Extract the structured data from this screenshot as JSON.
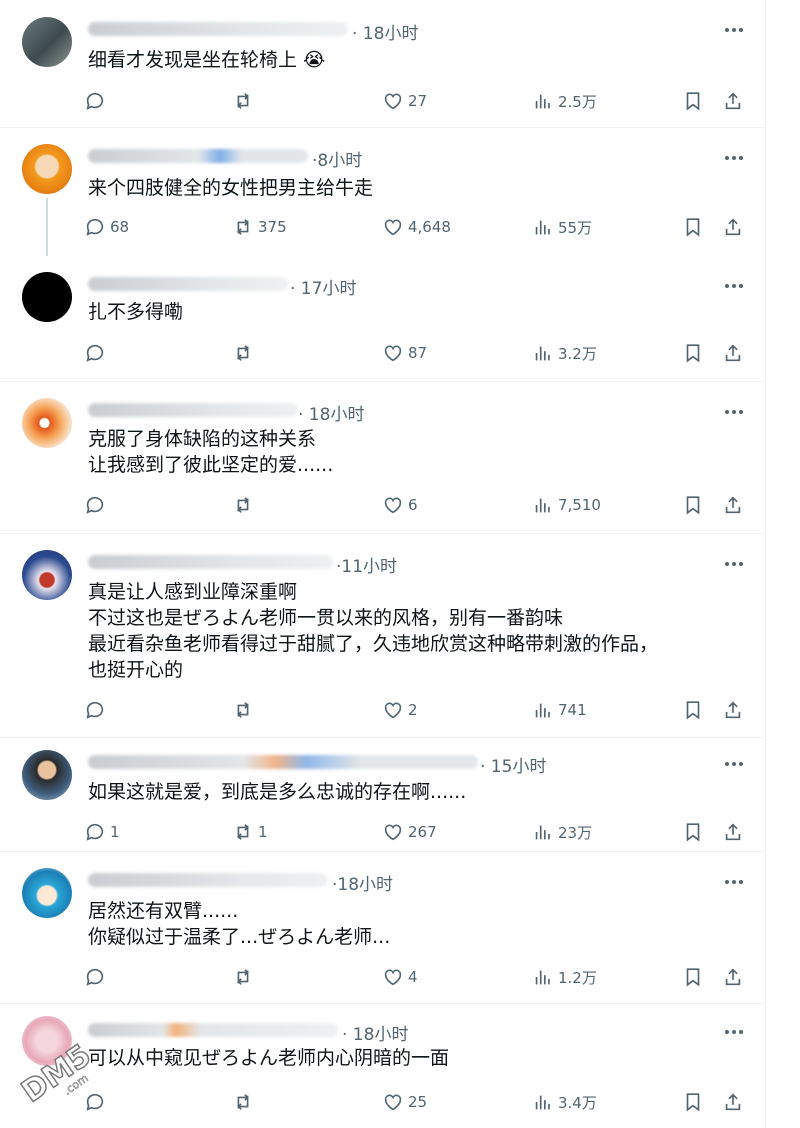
{
  "posts": [
    {
      "time": "· 18小时",
      "lines": [
        "细看才发现是坐在轮椅上 😭"
      ],
      "reply": "",
      "repost": "",
      "like": "27",
      "views": "2.5万"
    },
    {
      "time": "·8小时",
      "lines": [
        "来个四肢健全的女性把男主给牛走"
      ],
      "reply": "68",
      "repost": "375",
      "like": "4,648",
      "views": "55万"
    },
    {
      "time": "· 17小时",
      "lines": [
        "扎不多得嘞"
      ],
      "reply": "",
      "repost": "",
      "like": "87",
      "views": "3.2万"
    },
    {
      "time": "· 18小时",
      "lines": [
        "克服了身体缺陷的这种关系",
        "让我感到了彼此坚定的爱......"
      ],
      "reply": "",
      "repost": "",
      "like": "6",
      "views": "7,510"
    },
    {
      "time": "·11小时",
      "lines": [
        "真是让人感到业障深重啊",
        "不过这也是ぜろよん老师一贯以来的风格，别有一番韵味",
        "最近看杂鱼老师看得过于甜腻了，久违地欣赏这种略带刺激的作品，",
        "也挺开心的"
      ],
      "reply": "",
      "repost": "",
      "like": "2",
      "views": "741"
    },
    {
      "time": "· 15小时",
      "lines": [
        "如果这就是爱，到底是多么忠诚的存在啊......"
      ],
      "reply": "1",
      "repost": "1",
      "like": "267",
      "views": "23万"
    },
    {
      "time": "·18小时",
      "lines": [
        "居然还有双臂......",
        "你疑似过于温柔了...ぜろよん老师..."
      ],
      "reply": "",
      "repost": "",
      "like": "4",
      "views": "1.2万"
    },
    {
      "time": "· 18小时",
      "lines": [
        "可以从中窥见ぜろよん老师内心阴暗的一面"
      ],
      "reply": "",
      "repost": "",
      "like": "25",
      "views": "3.4万"
    }
  ],
  "watermark": "DM5.com",
  "icons": [
    "reply-icon",
    "repost-icon",
    "like-icon",
    "views-icon",
    "bookmark-icon",
    "share-icon",
    "more-icon"
  ],
  "colors": {
    "text": "#0f1419",
    "secondary": "#536471",
    "divider": "#eff3f4"
  }
}
